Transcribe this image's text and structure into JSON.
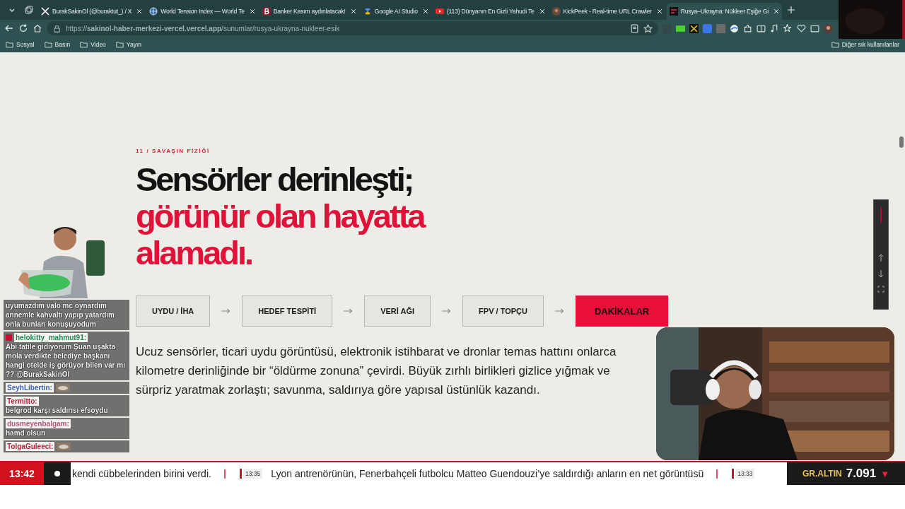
{
  "browser": {
    "tabs": [
      {
        "title": "BurakSakinOl (@buraktut_) / X",
        "selected": false
      },
      {
        "title": "World Tension Index — World Te",
        "selected": false
      },
      {
        "title": "Banker Kasım aydınlatacak!",
        "selected": false
      },
      {
        "title": "Google AI Studio",
        "selected": false
      },
      {
        "title": "(113) Dünyanın En Gizli Yahudi Te",
        "selected": false
      },
      {
        "title": "KickPeek - Real-time URL Crawler",
        "selected": false
      },
      {
        "title": "Rusya–Ukrayna: Nükleer Eşiğe Gi",
        "selected": true
      }
    ],
    "url": "https://**sakinol-haber-merkezi-vercel.vercel.app**/sunumlar/rusya-ukrayna-nukleer-esik",
    "bookmarks": [
      {
        "label": "Sosyal"
      },
      {
        "label": "Basın"
      },
      {
        "label": "Video"
      },
      {
        "label": "Yayın"
      }
    ],
    "other_bookmarks": "Diğer sık kullanılanlar"
  },
  "page": {
    "eyebrow": "11 / SAVAŞIN FİZİĞİ",
    "heading": [
      {
        "text": "Sensörler derinleşti;",
        "accent": false
      },
      {
        "text": "görünür olan hayatta",
        "accent": true
      },
      {
        "text": "alamadı.",
        "accent": true
      }
    ],
    "flow": [
      {
        "label": "UYDU / İHA",
        "highlight": false
      },
      {
        "label": "HEDEF TESPİTİ",
        "highlight": false
      },
      {
        "label": "VERİ AĞI",
        "highlight": false
      },
      {
        "label": "FPV / TOPÇU",
        "highlight": false
      },
      {
        "label": "DAKİKALAR",
        "highlight": true
      }
    ],
    "body": "Ucuz sensörler, ticari uydu görüntüsü, elektronik istihbarat ve dronlar temas hattını onlarca kilometre derinliğinde bir “öldürme zonuna” çevirdi. Büyük zırhlı birlikleri gizlice yığmak ve sürpriz yaratmak zorlaştı; savunma, saldırıya göre yapısal üstünlük kazandı."
  },
  "chat": [
    {
      "kind": "continuation",
      "text": "uyumazdım valo mc oynardım annemle kahvaltı yapıp yatardım onla bunları konuşuyodum"
    },
    {
      "kind": "highlight",
      "user": "helokitty_mahmut91:",
      "color": "#1f8a57",
      "text": "Abi tatile gidiyorum Şuan uşakta mola verdikte belediye başkanı hangi otelde iş görüyor bilen var mı ?? @BurakSakinOl"
    },
    {
      "kind": "emote",
      "user": "SeyhLibertin:",
      "color": "#3d62b3"
    },
    {
      "kind": "message",
      "user": "Termitto:",
      "color": "#b3203e",
      "text": "belgrod karşı saldırısı efsoydu"
    },
    {
      "kind": "message",
      "user": "dusmeyenbalgam:",
      "color": "#b5577d",
      "text": "hamd olsun"
    },
    {
      "kind": "emote",
      "user": "TolgaGuleeci:",
      "color": "#b3203e"
    }
  ],
  "ticker": {
    "clock": "13:42",
    "items": [
      {
        "text": "kendi cübbelerinden birini verdi."
      },
      {
        "time": "13:35",
        "text": "Lyon antrenörünün, Fenerbahçeli futbolcu Matteo Guendouzi’ye saldırdığı anların en net görüntüsü"
      },
      {
        "time": "13:33"
      }
    ]
  },
  "market": {
    "label": "GR.ALTIN",
    "value": "7.091",
    "trend": "▼"
  }
}
